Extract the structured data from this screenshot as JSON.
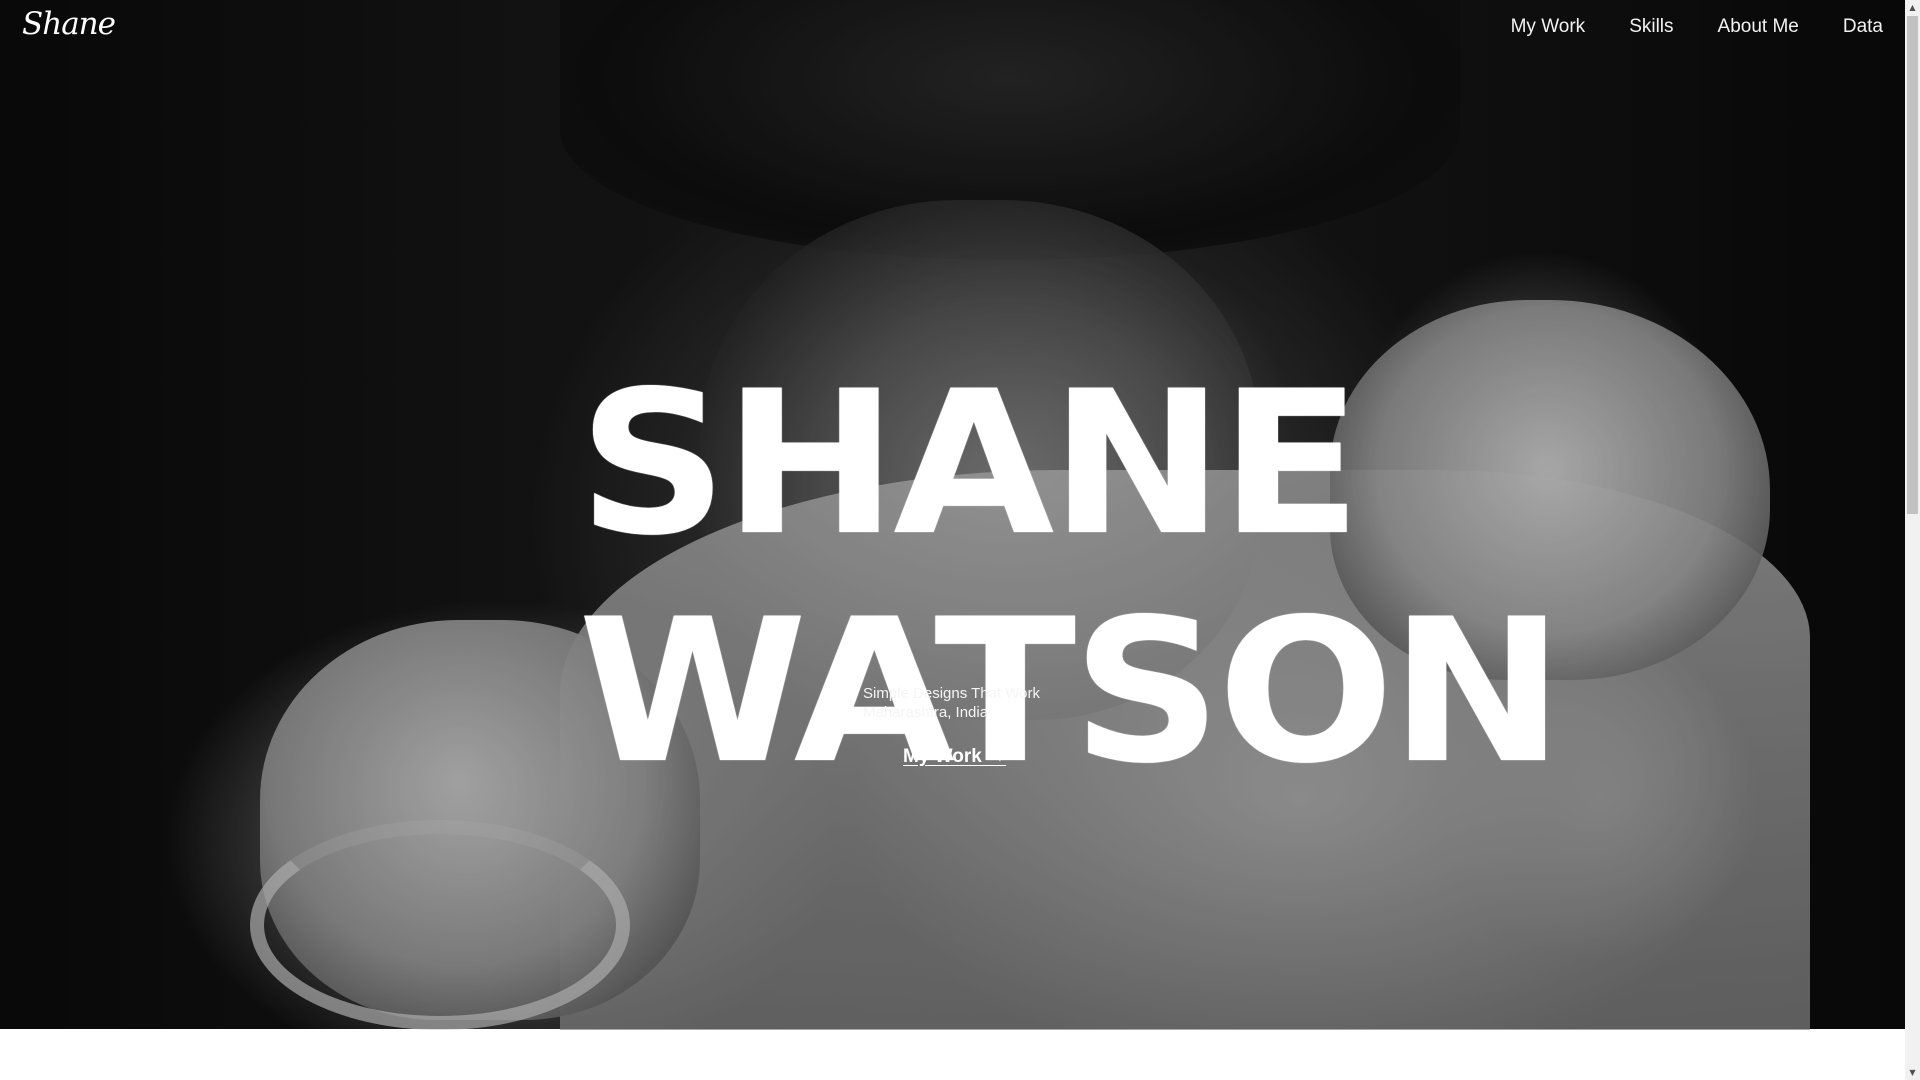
{
  "header": {
    "logo_text": "Shane",
    "nav": [
      {
        "label": "My Work"
      },
      {
        "label": "Skills"
      },
      {
        "label": "About Me"
      },
      {
        "label": "Data"
      }
    ]
  },
  "hero": {
    "title_line_1": "SHANE",
    "title_line_2": "WATSON",
    "tagline": "Simple Designs That Work",
    "location": "Maharashtra, India",
    "cta_label": "My Work →",
    "photo_description_icon": "portrait-photo"
  },
  "scrollbar": {
    "up_arrow": "▲",
    "down_arrow": "▼"
  },
  "colors": {
    "text": "#ffffff",
    "page_background": "#ffffff",
    "hero_background": "#141414"
  }
}
